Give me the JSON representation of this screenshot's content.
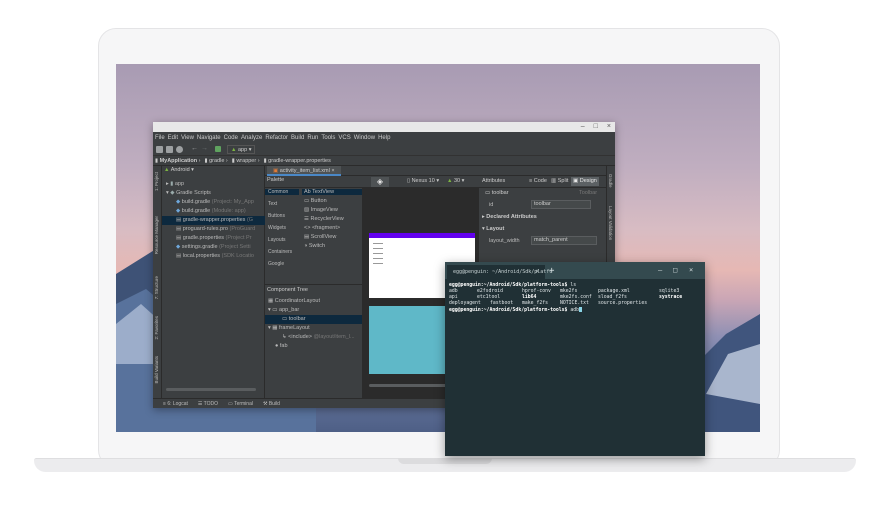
{
  "studio": {
    "menu": [
      "File",
      "Edit",
      "View",
      "Navigate",
      "Code",
      "Analyze",
      "Refactor",
      "Build",
      "Run",
      "Tools",
      "VCS",
      "Window",
      "Help"
    ],
    "window_controls": [
      "–",
      "□",
      "×"
    ],
    "toolbar": {
      "run_config": "app"
    },
    "breadcrumb": [
      "MyApplication",
      "gradle",
      "wrapper",
      "gradle-wrapper.properties"
    ],
    "project_view": "Android",
    "left_tabs": [
      "1: Project",
      "Resource Manager",
      "7: Structure",
      "2: Favorites",
      "Build Variants"
    ],
    "tree": [
      {
        "label": "app",
        "detail": ""
      },
      {
        "label": "Gradle Scripts",
        "detail": ""
      },
      {
        "label": "build.gradle",
        "detail": "(Project: My_App"
      },
      {
        "label": "build.gradle",
        "detail": "(Module: app)"
      },
      {
        "label": "gradle-wrapper.properties",
        "detail": "(G"
      },
      {
        "label": "proguard-rules.pro",
        "detail": "(ProGuard"
      },
      {
        "label": "gradle.properties",
        "detail": "(Project Pr"
      },
      {
        "label": "settings.gradle",
        "detail": "(Project Setti"
      },
      {
        "label": "local.properties",
        "detail": "(SDK Locatio"
      }
    ],
    "file_tab": "activity_item_list.xml",
    "modes": {
      "code": "Code",
      "split": "Split",
      "design": "Design"
    },
    "palette_title": "Palette",
    "palette_categories": [
      "Common",
      "Text",
      "Buttons",
      "Widgets",
      "Layouts",
      "Containers",
      "Google"
    ],
    "palette_items": [
      "Ab TextView",
      "Button",
      "ImageView",
      "RecyclerView",
      "<fragment>",
      "ScrollView",
      "Switch"
    ],
    "component_tree_title": "Component Tree",
    "component_tree": [
      {
        "label": "CoordinatorLayout",
        "detail": ""
      },
      {
        "label": "app_bar",
        "detail": ""
      },
      {
        "label": "toolbar",
        "detail": ""
      },
      {
        "label": "frameLayout",
        "detail": ""
      },
      {
        "label": "<include>",
        "detail": "@layout/item_l..."
      },
      {
        "label": "fab",
        "detail": ""
      }
    ],
    "device": "Nexus 10",
    "api": "30",
    "attributes": {
      "title": "Attributes",
      "component": "toolbar",
      "component_type": "Toolbar",
      "id_label": "id",
      "id_value": "toolbar",
      "declared": "Declared Attributes",
      "layout": "Layout",
      "layout_width_label": "layout_width",
      "layout_width_value": "match_parent"
    },
    "right_tabs": [
      "Gradle",
      "Layout Validation"
    ],
    "bottom_tabs": [
      "6: Logcat",
      "TODO",
      "Terminal",
      "Build"
    ]
  },
  "terminal": {
    "tab_title": "egg@penguin: ~/Android/Sdk/platfo",
    "prompt1_user": "egg@penguin",
    "prompt1_path": ":~/Android/Sdk/platform-tools$",
    "cmd1": "ls",
    "ls_rows": [
      [
        "adb",
        "e2fsdroid",
        "hprof-conv",
        "mke2fs",
        "package.xml",
        "sqlite3"
      ],
      [
        "api",
        "etc1tool",
        "lib64",
        "mke2fs.conf",
        "sload_f2fs",
        "systrace"
      ],
      [
        "deployagent",
        "fastboot",
        "make_f2fs",
        "NOTICE.txt",
        "source.properties",
        ""
      ]
    ],
    "prompt2_user": "egg@penguin",
    "prompt2_path": ":~/Android/Sdk/platform-tools$",
    "cmd2": "adb"
  }
}
